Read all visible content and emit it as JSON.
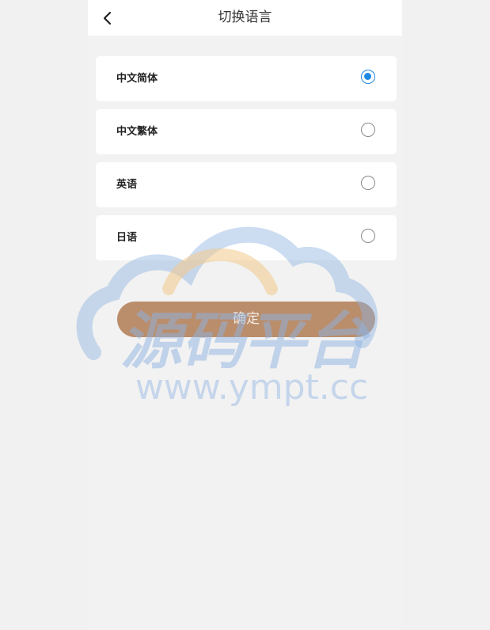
{
  "header": {
    "title": "切换语言",
    "back_icon": "chevron-left-icon"
  },
  "languages": [
    {
      "label": "中文简体",
      "selected": true
    },
    {
      "label": "中文繁体",
      "selected": false
    },
    {
      "label": "英语",
      "selected": false
    },
    {
      "label": "日语",
      "selected": false
    }
  ],
  "confirm_label": "确定",
  "watermark": {
    "text_cn": "源码平台",
    "text_url": "www.ympt.cc"
  },
  "colors": {
    "accent": "#1e88e5",
    "button": "#ba8d6b",
    "watermark_blue": "#8fb3e3",
    "watermark_orange": "#f2c98a"
  }
}
